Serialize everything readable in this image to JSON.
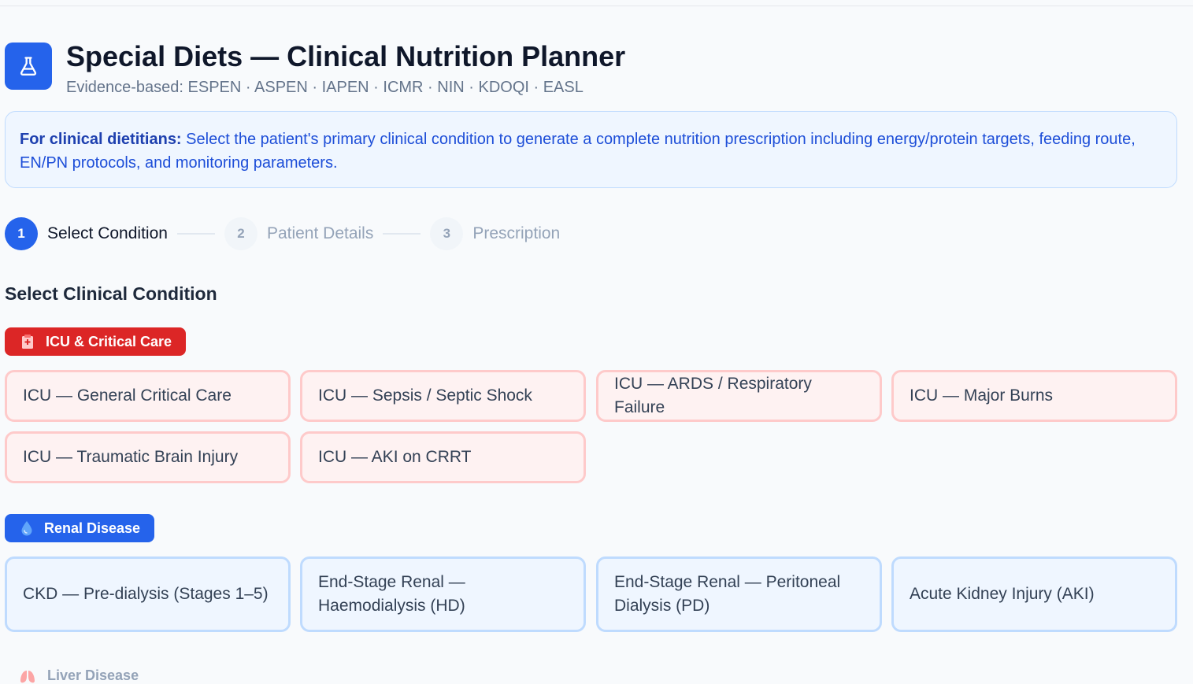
{
  "header": {
    "title": "Special Diets — Clinical Nutrition Planner",
    "subtitle": "Evidence-based: ESPEN · ASPEN · IAPEN · ICMR · NIN · KDOQI · EASL",
    "logo_icon": "flask-icon",
    "brand_color": "#2563eb"
  },
  "note": {
    "bold": "For clinical dietitians:",
    "text": " Select the patient's primary clinical condition to generate a complete nutrition prescription including energy/protein targets, feeding route, EN/PN protocols, and monitoring parameters."
  },
  "steps": [
    {
      "num": "1",
      "label": "Select Condition"
    },
    {
      "num": "2",
      "label": "Patient Details"
    },
    {
      "num": "3",
      "label": "Prescription"
    }
  ],
  "section_title": "Select Clinical Condition",
  "categories": {
    "icu": {
      "label": "ICU & Critical Care",
      "icon": "hospital-icon",
      "color": "#dc2626",
      "items": [
        "ICU — General Critical Care",
        "ICU — Sepsis / Septic Shock",
        "ICU — ARDS / Respiratory Failure",
        "ICU — Major Burns",
        "ICU — Traumatic Brain Injury",
        "ICU — AKI on CRRT"
      ]
    },
    "renal": {
      "label": "Renal Disease",
      "icon": "droplet-icon",
      "color": "#2563eb",
      "items": [
        "CKD — Pre-dialysis (Stages 1–5)",
        "End-Stage Renal — Haemodialysis (HD)",
        "End-Stage Renal — Peritoneal Dialysis (PD)",
        "Acute Kidney Injury (AKI)"
      ]
    },
    "liver": {
      "label": "Liver Disease",
      "icon": "lungs-icon"
    }
  }
}
